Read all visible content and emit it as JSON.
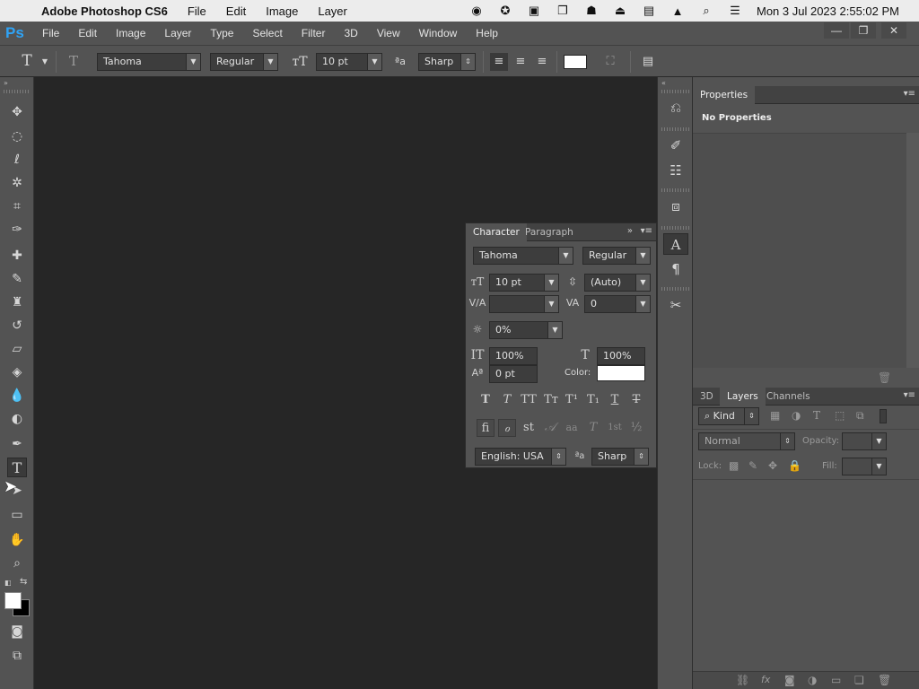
{
  "mac": {
    "app_name": "Adobe Photoshop CS6",
    "menus": [
      "File",
      "Edit",
      "Image",
      "Layer"
    ],
    "clock": "Mon 3 Jul 2023  2:55:02 PM"
  },
  "ps": {
    "logo": "Ps",
    "menus": [
      "File",
      "Edit",
      "Image",
      "Layer",
      "Type",
      "Select",
      "Filter",
      "3D",
      "View",
      "Window",
      "Help"
    ]
  },
  "options": {
    "font_family": "Tahoma",
    "font_style": "Regular",
    "font_size": "10 pt",
    "aa_label": "ªa",
    "antialias": "Sharp",
    "color": "#ffffff"
  },
  "properties": {
    "tab": "Properties",
    "status": "No Properties"
  },
  "character": {
    "tabs": [
      "Character",
      "Paragraph"
    ],
    "font_family": "Tahoma",
    "font_style": "Regular",
    "size": "10 pt",
    "leading": "(Auto)",
    "kerning": "",
    "tracking": "0",
    "tsume": "0%",
    "vscale": "100%",
    "hscale": "100%",
    "baseline": "0 pt",
    "color_label": "Color:",
    "color": "#ffffff",
    "language": "English: USA",
    "aa_label": "ªa",
    "antialias": "Sharp",
    "styles": [
      "T",
      "T",
      "TT",
      "Tт",
      "T¹",
      "T₁",
      "T",
      "T"
    ],
    "opentype": [
      "fi",
      "ℴ",
      "st",
      "𝒜",
      "aa",
      "T",
      "1st",
      "½"
    ]
  },
  "layers": {
    "tabs": [
      "3D",
      "Layers",
      "Channels"
    ],
    "kind": "Kind",
    "blend": "Normal",
    "opacity_label": "Opacity:",
    "lock_label": "Lock:",
    "fill_label": "Fill:"
  }
}
